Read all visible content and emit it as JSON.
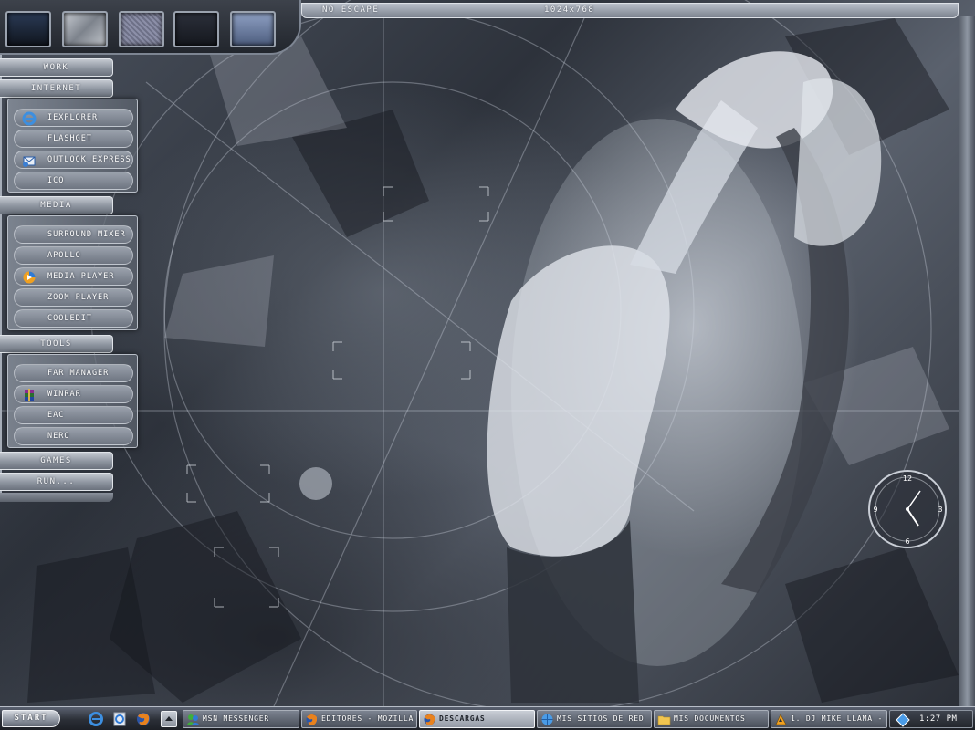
{
  "title_bar": {
    "theme_name": "NO ESCAPE",
    "resolution": "1024x768"
  },
  "launcher": {
    "categories": {
      "work": "WORK",
      "internet": "INTERNET",
      "media": "MEDIA",
      "tools": "TOOLS",
      "games": "GAMES",
      "run": "RUN..."
    },
    "internet_items": [
      {
        "label": "IEXPLORER",
        "icon": "internet-explorer-icon"
      },
      {
        "label": "FLASHGET",
        "icon": ""
      },
      {
        "label": "OUTLOOK EXPRESS",
        "icon": "outlook-express-icon"
      },
      {
        "label": "ICQ",
        "icon": ""
      }
    ],
    "media_items": [
      {
        "label": "SURROUND MIXER",
        "icon": ""
      },
      {
        "label": "APOLLO",
        "icon": ""
      },
      {
        "label": "MEDIA PLAYER",
        "icon": "media-player-icon"
      },
      {
        "label": "ZOOM PLAYER",
        "icon": ""
      },
      {
        "label": "COOLEDIT",
        "icon": ""
      }
    ],
    "tools_items": [
      {
        "label": "FAR MANAGER",
        "icon": ""
      },
      {
        "label": "WINRAR",
        "icon": "winrar-icon"
      },
      {
        "label": "EAC",
        "icon": ""
      },
      {
        "label": "NERO",
        "icon": ""
      }
    ]
  },
  "desktop_clock": {
    "numerals": [
      "12",
      "3",
      "6",
      "9"
    ]
  },
  "taskbar": {
    "start_label": "START",
    "tasks": [
      {
        "label": "MSN MESSENGER",
        "icon": "msn-messenger-icon",
        "active": false
      },
      {
        "label": "EDITORES - MOZILLA ...",
        "icon": "firefox-icon",
        "active": false
      },
      {
        "label": "DESCARGAS",
        "icon": "firefox-icon",
        "active": true
      },
      {
        "label": "MIS SITIOS DE RED",
        "icon": "network-places-icon",
        "active": false
      },
      {
        "label": "MIS DOCUMENTOS",
        "icon": "folder-icon",
        "active": false
      },
      {
        "label": "1. DJ MIKE LLAMA - L...",
        "icon": "winamp-icon",
        "active": false
      }
    ],
    "tray_time": "1:27 PM"
  },
  "colors": {
    "chrome_light": "#c4c9d1",
    "chrome_dark": "#2b2f37",
    "text": "#ffffff"
  }
}
